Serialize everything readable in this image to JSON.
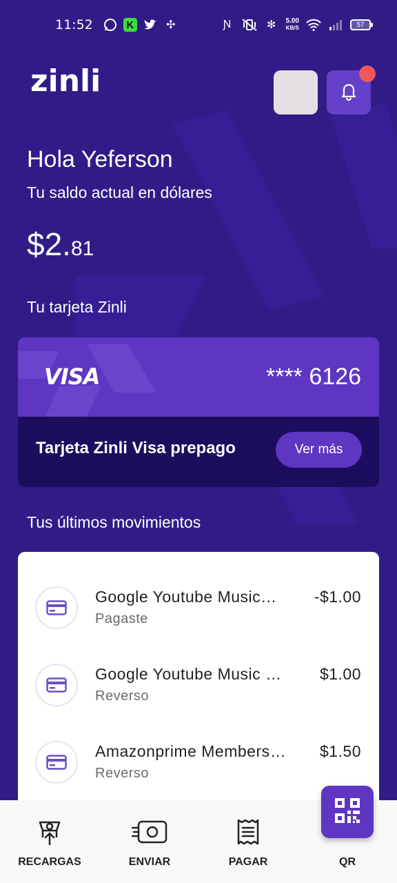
{
  "status_bar": {
    "time": "11:52",
    "net_speed_value": "5.00",
    "net_speed_unit": "KB/S",
    "battery": "57"
  },
  "header": {
    "logo": "zinli"
  },
  "greeting": "Hola Yeferson",
  "balance": {
    "label": "Tu saldo actual en dólares",
    "whole": "$2.",
    "cents": "81"
  },
  "card_section": {
    "title": "Tu tarjeta Zinli",
    "brand": "VISA",
    "number": "**** 6126",
    "name": "Tarjeta Zinli Visa prepago",
    "button": "Ver más"
  },
  "movements": {
    "title": "Tus últimos movimientos",
    "items": [
      {
        "name": "Google Youtube Music…",
        "type": "Pagaste",
        "amount": "-$1.00"
      },
      {
        "name": "Google Youtube Music 6…",
        "type": "Reverso",
        "amount": "$1.00"
      },
      {
        "name": "Amazonprime Members…",
        "type": "Reverso",
        "amount": "$1.50"
      }
    ]
  },
  "bottom_nav": {
    "items": [
      {
        "label": "RECARGAS",
        "icon": "recharge-icon"
      },
      {
        "label": "ENVIAR",
        "icon": "send-money-icon"
      },
      {
        "label": "PAGAR",
        "icon": "receipt-icon"
      },
      {
        "label": "QR",
        "icon": "qr-code-icon"
      }
    ]
  },
  "colors": {
    "background": "#311c87",
    "accent": "#5e36c2",
    "card_bottom": "#1c0d5e",
    "notification_dot": "#f0575d"
  }
}
